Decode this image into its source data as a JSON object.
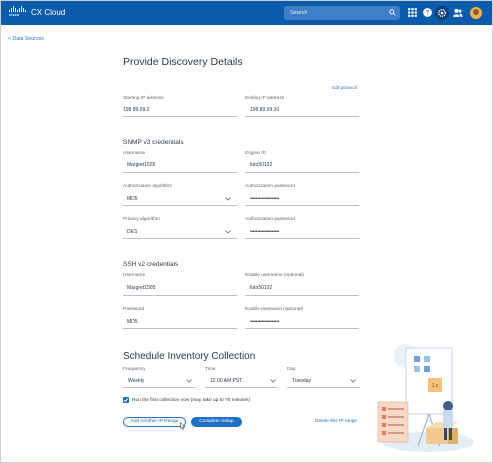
{
  "header": {
    "logo_text": "cisco",
    "app_title": "CX Cloud",
    "search_placeholder": "Search",
    "icons": [
      "apps-grid-icon",
      "help-icon",
      "settings-gear-icon",
      "users-icon",
      "user-avatar"
    ]
  },
  "nav": {
    "back_label": "< Data Sources"
  },
  "form": {
    "title": "Provide Discovery Details",
    "edit_protocol": "Edit protocol",
    "starting_ip_label": "Starting IP address",
    "starting_ip_value": "198.89.09.2",
    "ending_ip_label": "Ending IP address",
    "ending_ip_value": "198.89.09.10",
    "snmp": {
      "title": "SNMP v3 credentials",
      "username_label": "Username",
      "username_value": "Margret1505",
      "engine_label": "Engine ID",
      "engine_value": "futo50102",
      "auth_algo_label": "Authorization algorithm",
      "auth_algo_value": "MD5",
      "auth_pw_label": "Authorization password",
      "auth_pw_value": "••••••••••••••••••••",
      "priv_algo_label": "Privacy algorithm",
      "priv_algo_value": "DES",
      "priv_pw_label": "Authorization password",
      "priv_pw_value": "••••••••••••••••••••"
    },
    "ssh": {
      "title": "SSH v2 credentials",
      "username_label": "Username",
      "username_value": "Margret1505",
      "enable_user_label": "Enable username (optional)",
      "enable_user_value": "futo50102",
      "password_label": "Password",
      "password_value": "MD5",
      "enable_pw_label": "Enable password (optional)",
      "enable_pw_value": "••••••••••••••••••••"
    },
    "schedule": {
      "title": "Schedule Inventory Collection",
      "frequency_label": "Frequency",
      "frequency_value": "Weekly",
      "time_label": "Time",
      "time_value": "12:00 AM PST",
      "day_label": "Day",
      "day_value": "Tuesday",
      "run_now_label": "Run the first collection now (may take up to 75 minutes)",
      "run_now_checked": true
    },
    "actions": {
      "add_range": "Add Another IP Range",
      "complete": "Complete Setup",
      "delete_range": "Delete this IP range"
    }
  },
  "colors": {
    "header_bg": "#0d5cab",
    "accent": "#1f6fc7"
  }
}
